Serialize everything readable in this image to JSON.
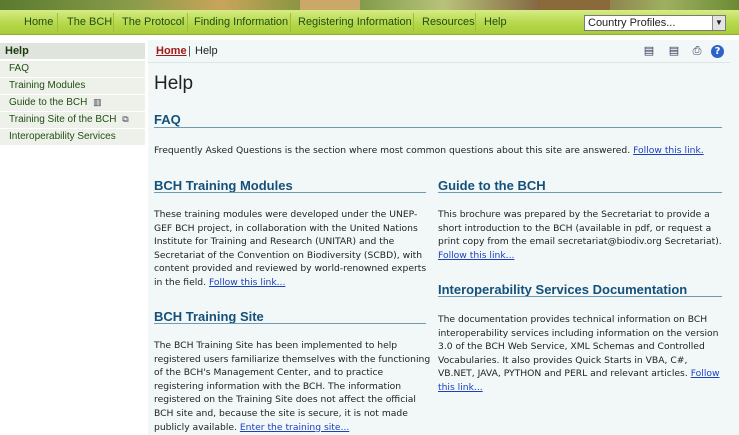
{
  "nav": {
    "items": [
      "Home",
      "The BCH",
      "The Protocol",
      "Finding Information",
      "Registering Information",
      "Resources",
      "Help"
    ],
    "country_select": "Country Profiles..."
  },
  "sidebar": {
    "header": "Help",
    "items": [
      {
        "label": "FAQ",
        "icon": ""
      },
      {
        "label": "Training Modules",
        "icon": ""
      },
      {
        "label": "Guide to the BCH",
        "icon": "book-icon"
      },
      {
        "label": "Training Site of the BCH",
        "icon": "external-window-icon"
      },
      {
        "label": "Interoperability Services",
        "icon": ""
      }
    ]
  },
  "breadcrumb": {
    "home": "Home",
    "separator": "|",
    "current": "Help"
  },
  "toolbar": {
    "icons": [
      "print-preview-icon",
      "printer-friendly-icon",
      "print-icon",
      "help-icon"
    ]
  },
  "page": {
    "title": "Help",
    "faq": {
      "title": "FAQ",
      "text": "Frequently Asked Questions is the section where most common questions about this site are answered.",
      "link": "Follow this link."
    },
    "training_modules": {
      "title": "BCH Training Modules",
      "lines": [
        "These training modules were developed under the UNEP-",
        "GEF BCH project, in collaboration with the United Nations",
        "Institute for Training and Research (UNITAR) and the",
        "Secretariat of the Convention on Biodiversity (SCBD), with",
        "content provided and reviewed by world-renowned experts"
      ],
      "last_line": "in the field.",
      "link": "Follow this link..."
    },
    "training_site": {
      "title": "BCH Training Site",
      "lines": [
        "The BCH Training Site has been implemented to help",
        "registered users familiarize themselves with the functioning",
        "of the BCH's Management Center, and to practice",
        "registering information with the BCH. The information",
        "registered on the Training Site does not affect the official",
        "BCH site and, because the site is secure, it is not made"
      ],
      "last_line": "publicly available.",
      "link": "Enter the training site..."
    },
    "guide": {
      "title": "Guide to the BCH",
      "lines": [
        "This brochure was prepared by the Secretariat to provide a",
        "short introduction to the BCH (available in pdf, or request a",
        "print copy from the email secretariat@biodiv.org Secretariat)."
      ],
      "link": "Follow this link..."
    },
    "interop": {
      "title": "Interoperability Services Documentation",
      "lines": [
        "The documentation provides technical information on BCH",
        "interoperability services including information on the version",
        "3.0 of the BCH Web Service, XML Schemas and Controlled",
        "Vocabularies. It also provides Quick Starts in VBA, C#,"
      ],
      "last_line": "VB.NET, JAVA, PYTHON and PERL and relevant articles.",
      "link_part1": "Follow",
      "link_part2": "this link..."
    }
  }
}
